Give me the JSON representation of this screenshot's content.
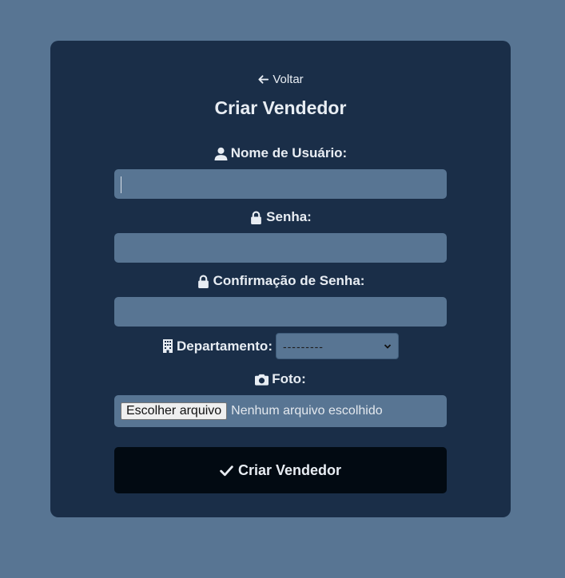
{
  "back_link": {
    "label": "Voltar",
    "icon": "arrow-left-icon"
  },
  "page_title": "Criar Vendedor",
  "fields": {
    "username": {
      "label": "Nome de Usuário:",
      "icon": "user-icon",
      "value": ""
    },
    "password": {
      "label": "Senha:",
      "icon": "lock-icon",
      "value": ""
    },
    "password_confirm": {
      "label": "Confirmação de Senha:",
      "icon": "lock-icon",
      "value": ""
    },
    "department": {
      "label": "Departamento:",
      "icon": "building-icon",
      "selected": "---------"
    },
    "photo": {
      "label": "Foto:",
      "icon": "camera-icon",
      "button_label": "Escolher arquivo",
      "status": "Nenhum arquivo escolhido"
    }
  },
  "submit": {
    "label": "Criar Vendedor",
    "icon": "check-icon"
  },
  "colors": {
    "page_bg": "#587593",
    "card_bg": "#1a2e48",
    "input_bg": "#587593",
    "button_bg": "#020a12",
    "text": "#e8edf3"
  }
}
